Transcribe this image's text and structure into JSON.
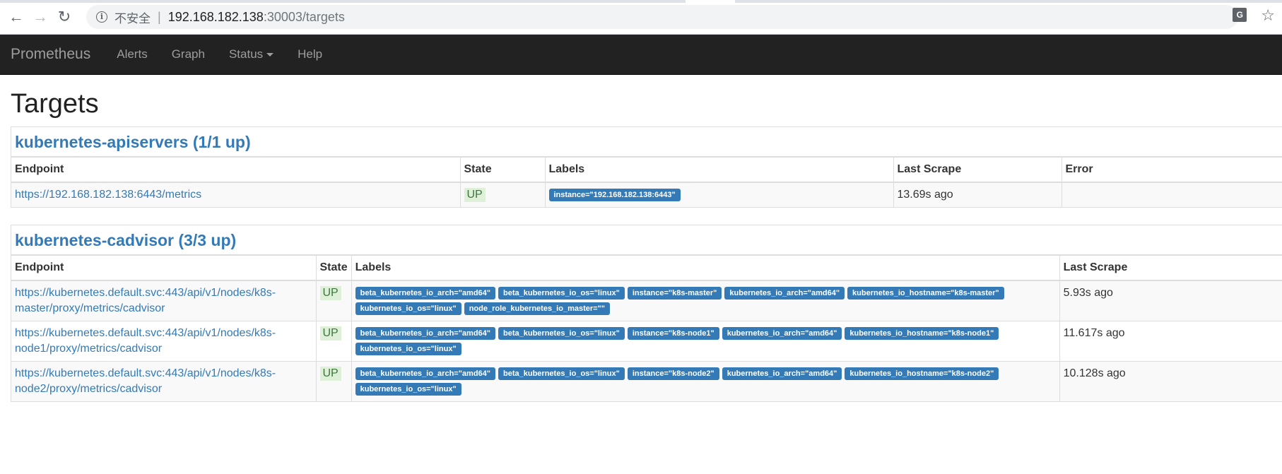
{
  "browser": {
    "back_icon": "arrow-left-icon",
    "forward_icon": "arrow-right-icon",
    "reload_icon": "reload-icon",
    "insecure_label": "不安全",
    "url_host": "192.168.182.138",
    "url_rest": ":30003/targets",
    "translate_icon": "translate-icon",
    "bookmark_icon": "star-icon"
  },
  "navbar": {
    "brand": "Prometheus",
    "links": [
      "Alerts",
      "Graph",
      "Status",
      "Help"
    ]
  },
  "page": {
    "title": "Targets"
  },
  "sections": [
    {
      "title": "kubernetes-apiservers (1/1 up)",
      "headers": [
        "Endpoint",
        "State",
        "Labels",
        "Last Scrape",
        "Error"
      ],
      "rows": [
        {
          "endpoint": "https://192.168.182.138:6443/metrics",
          "state": "UP",
          "labels": [
            "instance=\"192.168.182.138:6443\""
          ],
          "last_scrape": "13.69s ago",
          "error": ""
        }
      ]
    },
    {
      "title": "kubernetes-cadvisor (3/3 up)",
      "headers": [
        "Endpoint",
        "State",
        "Labels",
        "Last Scrape"
      ],
      "rows": [
        {
          "endpoint": "https://kubernetes.default.svc:443/api/v1/nodes/k8s-master/proxy/metrics/cadvisor",
          "state": "UP",
          "labels": [
            "beta_kubernetes_io_arch=\"amd64\"",
            "beta_kubernetes_io_os=\"linux\"",
            "instance=\"k8s-master\"",
            "kubernetes_io_arch=\"amd64\"",
            "kubernetes_io_hostname=\"k8s-master\"",
            "kubernetes_io_os=\"linux\"",
            "node_role_kubernetes_io_master=\"\""
          ],
          "last_scrape": "5.93s ago"
        },
        {
          "endpoint": "https://kubernetes.default.svc:443/api/v1/nodes/k8s-node1/proxy/metrics/cadvisor",
          "state": "UP",
          "labels": [
            "beta_kubernetes_io_arch=\"amd64\"",
            "beta_kubernetes_io_os=\"linux\"",
            "instance=\"k8s-node1\"",
            "kubernetes_io_arch=\"amd64\"",
            "kubernetes_io_hostname=\"k8s-node1\"",
            "kubernetes_io_os=\"linux\""
          ],
          "last_scrape": "11.617s ago"
        },
        {
          "endpoint": "https://kubernetes.default.svc:443/api/v1/nodes/k8s-node2/proxy/metrics/cadvisor",
          "state": "UP",
          "labels": [
            "beta_kubernetes_io_arch=\"amd64\"",
            "beta_kubernetes_io_os=\"linux\"",
            "instance=\"k8s-node2\"",
            "kubernetes_io_arch=\"amd64\"",
            "kubernetes_io_hostname=\"k8s-node2\"",
            "kubernetes_io_os=\"linux\""
          ],
          "last_scrape": "10.128s ago"
        }
      ]
    }
  ]
}
